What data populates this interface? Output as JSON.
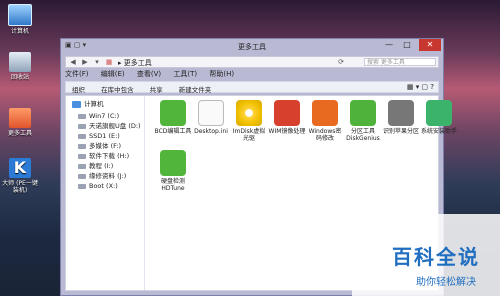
{
  "desktop": {
    "icons": [
      {
        "name": "computer",
        "label": "计算机"
      },
      {
        "name": "recycle-bin",
        "label": "回收站"
      },
      {
        "name": "more-tools-folder",
        "label": "更多工具"
      },
      {
        "name": "k-app",
        "label": "大师 (PE一键装机)"
      }
    ]
  },
  "window": {
    "title": "更多工具",
    "close_symbol": "✕",
    "minimize_symbol": "—",
    "maximize_symbol": "□",
    "address": {
      "path": "更多工具",
      "search_placeholder": "搜索 更多工具"
    },
    "menu": [
      "文件(F)",
      "编辑(E)",
      "查看(V)",
      "工具(T)",
      "帮助(H)"
    ],
    "toolbar": [
      "组织",
      "在库中包含",
      "共享",
      "新建文件夹"
    ],
    "nav": [
      {
        "label": "计算机",
        "root": true
      },
      {
        "label": "Win7 (C:)"
      },
      {
        "label": "天诺旗舰U盘 (D:)"
      },
      {
        "label": "SSD1 (E:)"
      },
      {
        "label": "多媒体 (F:)"
      },
      {
        "label": "软件下载 (H:)"
      },
      {
        "label": "教程 (I:)"
      },
      {
        "label": "缘修资料 (J:)"
      },
      {
        "label": "Boot (X:)"
      }
    ],
    "files": [
      {
        "label": "BCD编辑工具",
        "icon": "ico-green"
      },
      {
        "label": "Desktop.ini",
        "icon": "ico-doc"
      },
      {
        "label": "ImDisk虚拟光驱",
        "icon": "ico-disc"
      },
      {
        "label": "WIM镜像处理",
        "icon": "ico-wim"
      },
      {
        "label": "Windows密码修改",
        "icon": "ico-office"
      },
      {
        "label": "分区工具DiskGenius",
        "icon": "ico-wrench"
      },
      {
        "label": "识别苹果分区",
        "icon": "ico-apple"
      },
      {
        "label": "系统安装助手",
        "icon": "ico-run"
      },
      {
        "label": "硬盘检测HDTune",
        "icon": "ico-green"
      }
    ]
  },
  "watermark": {
    "title": "百科全说",
    "subtitle": "助你轻松解决"
  }
}
